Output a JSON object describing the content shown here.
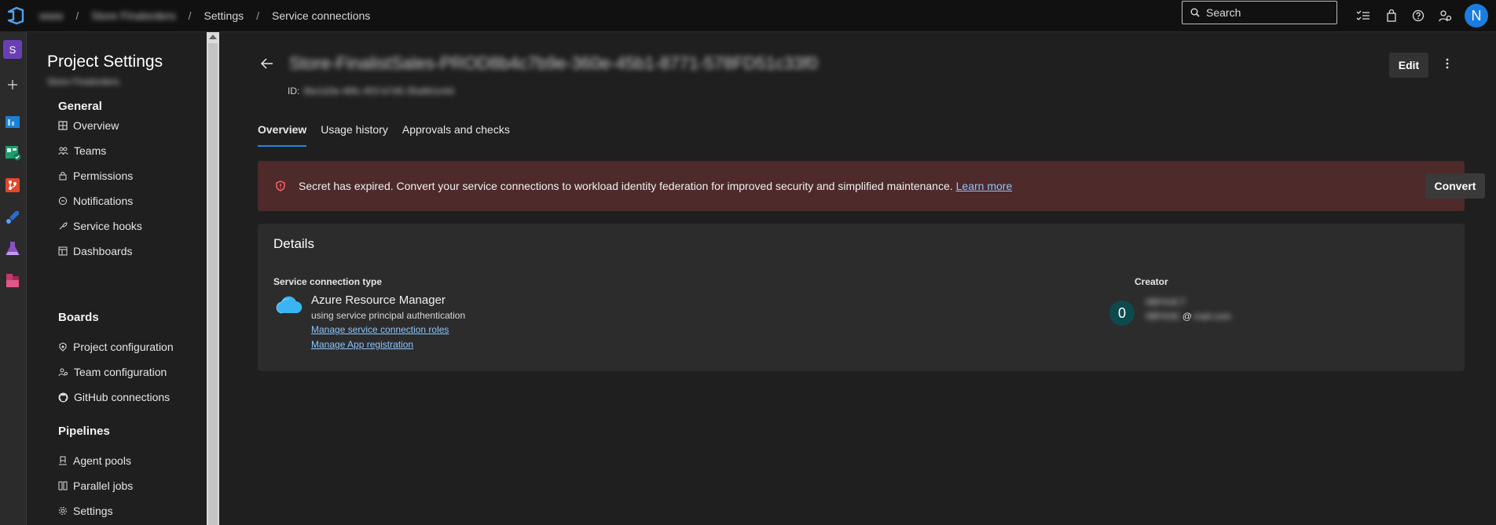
{
  "topbar": {
    "breadcrumbs": [
      "www",
      "Store Finalorders",
      "Settings",
      "Service connections"
    ],
    "separator": "/",
    "search_placeholder": "Search",
    "user_initial": "N"
  },
  "rail": {
    "project_initial": "S"
  },
  "sidebar": {
    "title": "Project Settings",
    "subtitle": "Store Finalorders",
    "sections": [
      {
        "heading": "General",
        "items": [
          "Overview",
          "Teams",
          "Permissions",
          "Notifications",
          "Service hooks",
          "Dashboards"
        ]
      },
      {
        "heading": "Boards",
        "items": [
          "Project configuration",
          "Team configuration",
          "GitHub connections"
        ]
      },
      {
        "heading": "Pipelines",
        "items": [
          "Agent pools",
          "Parallel jobs",
          "Settings"
        ]
      }
    ]
  },
  "header": {
    "connection_name": "Store-FinalistSales-PROD8b4c7b9e-360e-45b1-8771-578FD51c33f0",
    "id_label": "ID:",
    "id_value": "3be1d3e-46fc-4f1f-b7d5-35a6b1e4d",
    "edit_label": "Edit"
  },
  "tabs": [
    "Overview",
    "Usage history",
    "Approvals and checks"
  ],
  "banner": {
    "message": "Secret has expired. Convert your service connections to workload identity federation for improved security and simplified maintenance.",
    "link": "Learn more",
    "button": "Convert",
    "color": "#4e2a2a"
  },
  "details": {
    "heading": "Details",
    "type_label": "Service connection type",
    "type_name": "Azure Resource Manager",
    "type_sub": "using service principal authentication",
    "links": [
      "Manage service connection roles",
      "Manage App registration"
    ],
    "creator_label": "Creator",
    "creator_initial": "0",
    "creator_name": "0BFA3C7",
    "creator_email_user": "0BFA3C",
    "creator_at": "@",
    "creator_email_domain": "mail.com"
  },
  "colors": {
    "accent": "#1b89e8",
    "link": "#8cc4ff",
    "avatar": "#1a7de0"
  }
}
